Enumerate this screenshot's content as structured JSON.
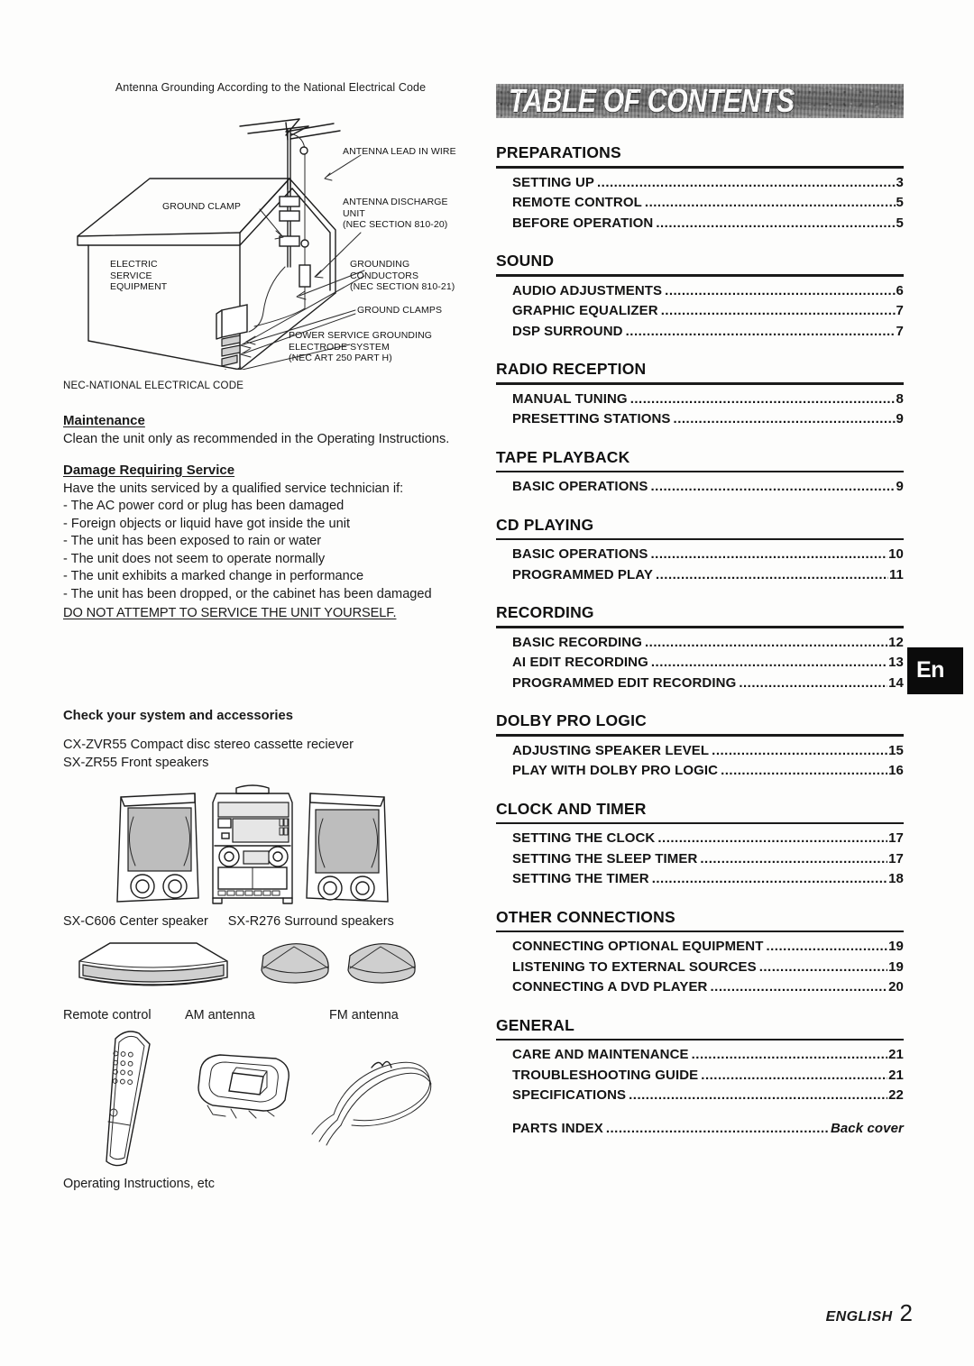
{
  "page": {
    "footer_language": "ENGLISH",
    "footer_page_number": "2",
    "language_tab": "En"
  },
  "left_column": {
    "diagram": {
      "caption": "Antenna Grounding According to the National Electrical Code",
      "labels": {
        "antenna_lead_in_wire": "ANTENNA LEAD IN WIRE",
        "antenna_discharge_unit": "ANTENNA DISCHARGE\nUNIT\n(NEC SECTION 810-20)",
        "ground_clamp": "GROUND CLAMP",
        "electric_service_equipment": "ELECTRIC\nSERVICE\nEQUIPMENT",
        "grounding_conductors": "GROUNDING\nCONDUCTORS\n(NEC SECTION 810-21)",
        "ground_clamps": "GROUND CLAMPS",
        "power_service_grounding": "POWER SERVICE GROUNDING\nELECTRODE SYSTEM\n(NEC ART 250 PART H)"
      },
      "footnote": "NEC-NATIONAL ELECTRICAL CODE"
    },
    "maintenance": {
      "heading": "Maintenance",
      "body": "Clean the unit only as recommended in the Operating Instructions."
    },
    "damage_requiring_service": {
      "heading": "Damage Requiring Service",
      "intro": "Have the units serviced by a qualified service technician if:",
      "items": [
        "- The AC power cord or plug has been damaged",
        "- Foreign objects or liquid have got inside the unit",
        "- The unit has been exposed to rain or water",
        "- The unit does not seem to operate normally",
        "- The unit exhibits a marked change in performance",
        "- The unit has been dropped, or the cabinet has been damaged"
      ],
      "warning": "DO NOT ATTEMPT TO SERVICE THE UNIT YOURSELF."
    },
    "accessories": {
      "heading": "Check your system and accessories",
      "main_units": [
        "CX-ZVR55 Compact disc stereo cassette reciever",
        "SX-ZR55 Front speakers"
      ],
      "speaker_captions": [
        "SX-C606 Center speaker",
        "SX-R276 Surround speakers"
      ],
      "item_captions": [
        "Remote control",
        "AM antenna",
        "FM antenna"
      ],
      "final_caption": "Operating Instructions, etc"
    }
  },
  "right_column": {
    "banner_title": "TABLE OF CONTENTS",
    "groups": [
      {
        "title": "PREPARATIONS",
        "entries": [
          {
            "label": "SETTING UP",
            "page": "3"
          },
          {
            "label": "REMOTE CONTROL",
            "page": "5"
          },
          {
            "label": "BEFORE OPERATION",
            "page": "5"
          }
        ]
      },
      {
        "title": "SOUND",
        "entries": [
          {
            "label": "AUDIO ADJUSTMENTS",
            "page": "6"
          },
          {
            "label": "GRAPHIC EQUALIZER",
            "page": "7"
          },
          {
            "label": "DSP SURROUND",
            "page": "7"
          }
        ]
      },
      {
        "title": "RADIO RECEPTION",
        "entries": [
          {
            "label": "MANUAL TUNING",
            "page": "8"
          },
          {
            "label": "PRESETTING STATIONS",
            "page": "9"
          }
        ]
      },
      {
        "title": "TAPE PLAYBACK",
        "entries": [
          {
            "label": "BASIC OPERATIONS",
            "page": "9"
          }
        ]
      },
      {
        "title": "CD PLAYING",
        "entries": [
          {
            "label": "BASIC OPERATIONS",
            "page": "10"
          },
          {
            "label": "PROGRAMMED PLAY",
            "page": "11"
          }
        ]
      },
      {
        "title": "RECORDING",
        "entries": [
          {
            "label": "BASIC RECORDING",
            "page": "12"
          },
          {
            "label": "AI EDIT RECORDING",
            "page": "13"
          },
          {
            "label": "PROGRAMMED EDIT RECORDING",
            "page": "14"
          }
        ]
      },
      {
        "title": "DOLBY PRO LOGIC",
        "entries": [
          {
            "label": "ADJUSTING SPEAKER LEVEL",
            "page": "15"
          },
          {
            "label": "PLAY WITH DOLBY PRO LOGIC",
            "page": "16"
          }
        ]
      },
      {
        "title": "CLOCK AND TIMER",
        "entries": [
          {
            "label": "SETTING THE CLOCK",
            "page": "17"
          },
          {
            "label": "SETTING THE SLEEP TIMER",
            "page": "17"
          },
          {
            "label": "SETTING THE TIMER",
            "page": "18"
          }
        ]
      },
      {
        "title": "OTHER CONNECTIONS",
        "entries": [
          {
            "label": "CONNECTING OPTIONAL EQUIPMENT",
            "page": "19"
          },
          {
            "label": "LISTENING TO EXTERNAL SOURCES",
            "page": "19"
          },
          {
            "label": "CONNECTING A DVD PLAYER",
            "page": "20"
          }
        ]
      },
      {
        "title": "GENERAL",
        "entries": [
          {
            "label": "CARE AND MAINTENANCE",
            "page": "21"
          },
          {
            "label": "TROUBLESHOOTING GUIDE",
            "page": "21"
          },
          {
            "label": "SPECIFICATIONS",
            "page": "22"
          },
          {
            "label": "PARTS INDEX",
            "page": "Back cover",
            "italic_page": true,
            "spaced": true
          }
        ]
      }
    ]
  }
}
